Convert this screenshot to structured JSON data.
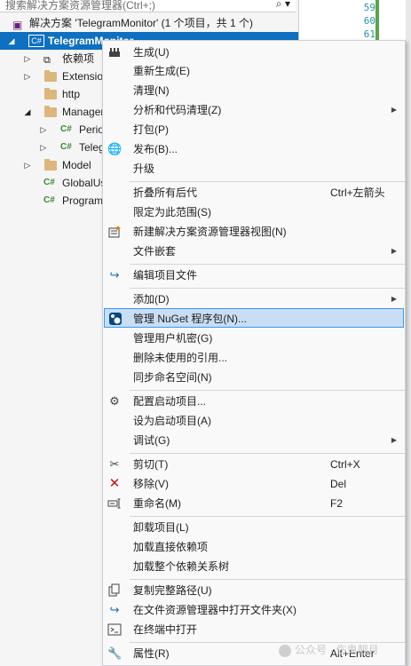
{
  "explorer": {
    "search_placeholder": "搜索解决方案资源管理器(Ctrl+;)",
    "search_icon": "search-icon",
    "solution_label": "解决方案 'TelegramMonitor' (1 个项目，共 1 个)",
    "project_label": "TelegramMonitor",
    "nodes": [
      {
        "label": "依赖项",
        "icon": "dependencies-icon"
      },
      {
        "label": "Extensions",
        "icon": "folder-icon"
      },
      {
        "label": "http",
        "icon": "folder-icon"
      },
      {
        "label": "Manager",
        "icon": "folder-icon"
      },
      {
        "label": "Periodic",
        "icon": "csharp-icon"
      },
      {
        "label": "Telegram",
        "icon": "csharp-icon"
      },
      {
        "label": "Model",
        "icon": "folder-icon"
      },
      {
        "label": "GlobalUsings",
        "icon": "csharp-icon"
      },
      {
        "label": "Program",
        "icon": "csharp-icon"
      }
    ]
  },
  "editor": {
    "line_numbers": [
      "59",
      "60",
      "61"
    ],
    "change_marker_color": "#57a64a"
  },
  "context_menu": {
    "items": [
      {
        "label": "生成(U)",
        "icon": "build-icon"
      },
      {
        "label": "重新生成(E)"
      },
      {
        "label": "清理(N)"
      },
      {
        "label": "分析和代码清理(Z)",
        "submenu": true
      },
      {
        "label": "打包(P)"
      },
      {
        "label": "发布(B)...",
        "icon": "globe-icon"
      },
      {
        "label": "升级"
      },
      {
        "label": "折叠所有后代",
        "shortcut": "Ctrl+左箭头"
      },
      {
        "label": "限定为此范围(S)"
      },
      {
        "label": "新建解决方案资源管理器视图(N)",
        "icon": "new-view-icon"
      },
      {
        "label": "文件嵌套",
        "submenu": true
      },
      {
        "label": "编辑项目文件",
        "icon": "edit-project-icon"
      },
      {
        "label": "添加(D)",
        "submenu": true
      },
      {
        "label": "管理 NuGet 程序包(N)...",
        "icon": "nuget-icon",
        "highlighted": true
      },
      {
        "label": "管理用户机密(G)"
      },
      {
        "label": "删除未使用的引用..."
      },
      {
        "label": "同步命名空间(N)"
      },
      {
        "label": "配置启动项目...",
        "icon": "gear-icon"
      },
      {
        "label": "设为启动项目(A)"
      },
      {
        "label": "调试(G)",
        "submenu": true
      },
      {
        "label": "剪切(T)",
        "icon": "scissors-icon",
        "shortcut": "Ctrl+X"
      },
      {
        "label": "移除(V)",
        "icon": "remove-icon",
        "shortcut": "Del"
      },
      {
        "label": "重命名(M)",
        "icon": "rename-icon",
        "shortcut": "F2"
      },
      {
        "label": "卸载项目(L)"
      },
      {
        "label": "加载直接依赖项"
      },
      {
        "label": "加载整个依赖关系树"
      },
      {
        "label": "复制完整路径(U)",
        "icon": "copy-path-icon"
      },
      {
        "label": "在文件资源管理器中打开文件夹(X)",
        "icon": "open-folder-icon"
      },
      {
        "label": "在终端中打开",
        "icon": "terminal-icon"
      },
      {
        "label": "属性(R)",
        "icon": "wrench-icon",
        "shortcut": "Alt+Enter"
      }
    ]
  },
  "watermark": {
    "text": "公众号 · 伤鬼靓月"
  },
  "colors": {
    "selection_blue": "#0e70c0",
    "highlight_bg": "#c9def5",
    "highlight_border": "#3399ff"
  }
}
